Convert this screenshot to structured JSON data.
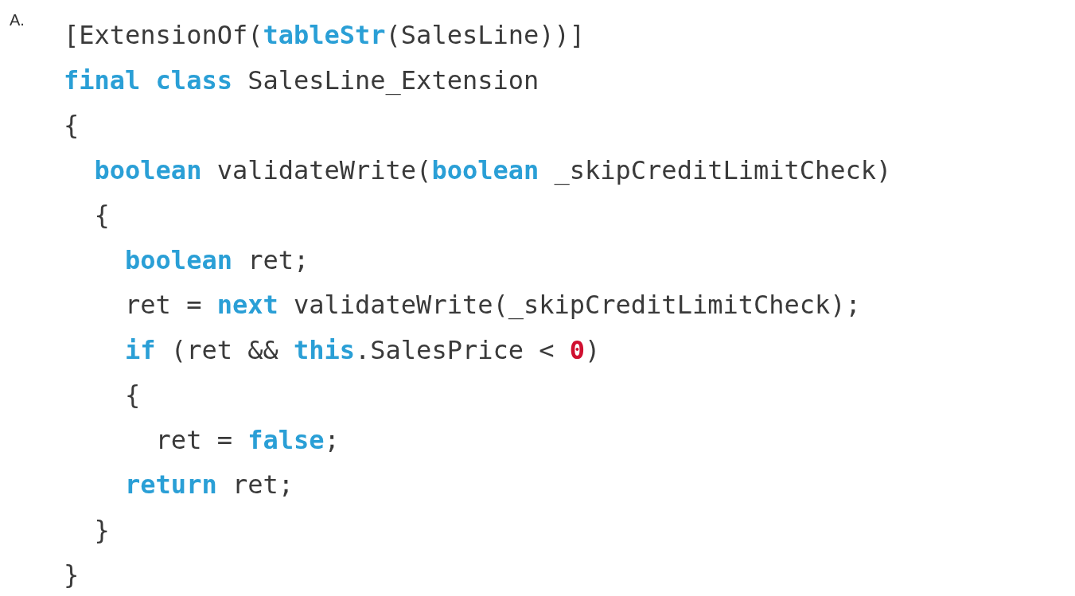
{
  "option_label": "A.",
  "code_lines": [
    {
      "tokens": [
        {
          "text": "[ExtensionOf(",
          "kind": "plain"
        },
        {
          "text": "tableStr",
          "kind": "keyword"
        },
        {
          "text": "(SalesLine))]",
          "kind": "plain"
        }
      ]
    },
    {
      "tokens": [
        {
          "text": "final class",
          "kind": "keyword"
        },
        {
          "text": " SalesLine_Extension",
          "kind": "plain"
        }
      ]
    },
    {
      "tokens": [
        {
          "text": "{",
          "kind": "plain"
        }
      ]
    },
    {
      "tokens": [
        {
          "text": "  boolean",
          "kind": "keyword"
        },
        {
          "text": " validateWrite(",
          "kind": "plain"
        },
        {
          "text": "boolean",
          "kind": "keyword"
        },
        {
          "text": " _skipCreditLimitCheck)",
          "kind": "plain"
        }
      ]
    },
    {
      "tokens": [
        {
          "text": "  {",
          "kind": "plain"
        }
      ]
    },
    {
      "tokens": [
        {
          "text": "    boolean",
          "kind": "keyword"
        },
        {
          "text": " ret;",
          "kind": "plain"
        }
      ]
    },
    {
      "tokens": [
        {
          "text": "    ret = ",
          "kind": "plain"
        },
        {
          "text": "next",
          "kind": "keyword"
        },
        {
          "text": " validateWrite(_skipCreditLimitCheck);",
          "kind": "plain"
        }
      ]
    },
    {
      "tokens": [
        {
          "text": "    if",
          "kind": "keyword"
        },
        {
          "text": " (ret && ",
          "kind": "plain"
        },
        {
          "text": "this",
          "kind": "keyword"
        },
        {
          "text": ".SalesPrice < ",
          "kind": "plain"
        },
        {
          "text": "0",
          "kind": "number"
        },
        {
          "text": ")",
          "kind": "plain"
        }
      ]
    },
    {
      "tokens": [
        {
          "text": "    {",
          "kind": "plain"
        }
      ]
    },
    {
      "tokens": [
        {
          "text": "      ret = ",
          "kind": "plain"
        },
        {
          "text": "false",
          "kind": "keyword"
        },
        {
          "text": ";",
          "kind": "plain"
        }
      ]
    },
    {
      "tokens": [
        {
          "text": "    return",
          "kind": "keyword"
        },
        {
          "text": " ret;",
          "kind": "plain"
        }
      ]
    },
    {
      "tokens": [
        {
          "text": "  }",
          "kind": "plain"
        }
      ]
    },
    {
      "tokens": [
        {
          "text": "}",
          "kind": "plain"
        }
      ]
    }
  ]
}
